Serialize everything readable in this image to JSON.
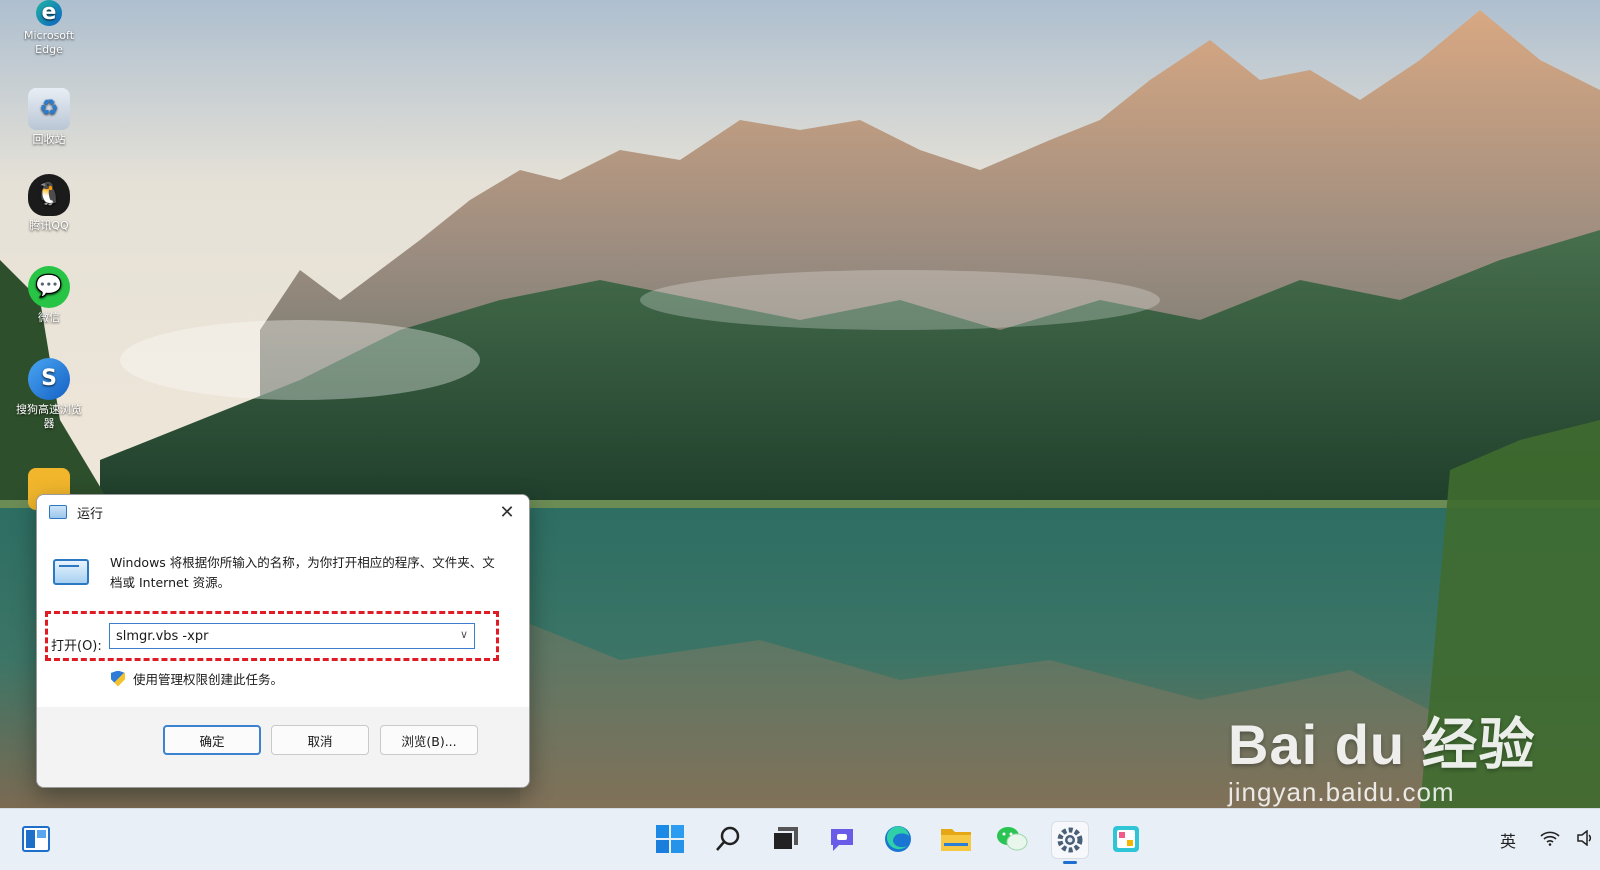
{
  "desktop": {
    "icons": [
      {
        "label": "Microsoft\nEdge",
        "icon": "edge-icon"
      },
      {
        "label": "回收站",
        "icon": "recycle-bin-icon"
      },
      {
        "label": "腾讯QQ",
        "icon": "qq-icon"
      },
      {
        "label": "微信",
        "icon": "wechat-icon"
      },
      {
        "label": "搜狗高速浏览器",
        "icon": "sogou-browser-icon"
      }
    ]
  },
  "run_dialog": {
    "title": "运行",
    "description": "Windows 将根据你所输入的名称，为你打开相应的程序、文件夹、文档或 Internet 资源。",
    "open_label": "打开(O):",
    "open_value": "slmgr.vbs -xpr",
    "admin_note": "使用管理权限创建此任务。",
    "buttons": {
      "ok": "确定",
      "cancel": "取消",
      "browse": "浏览(B)..."
    },
    "highlight_color": "#e01b24"
  },
  "taskbar": {
    "input_method": "英",
    "icons": [
      "widgets-icon",
      "start-icon",
      "search-icon",
      "task-view-icon",
      "teams-chat-icon",
      "edge-icon",
      "file-explorer-icon",
      "wechat-icon",
      "settings-icon",
      "paint-icon"
    ],
    "active": "settings-icon"
  },
  "watermark": {
    "main": "Bai du 经验",
    "sub": "jingyan.baidu.com"
  }
}
